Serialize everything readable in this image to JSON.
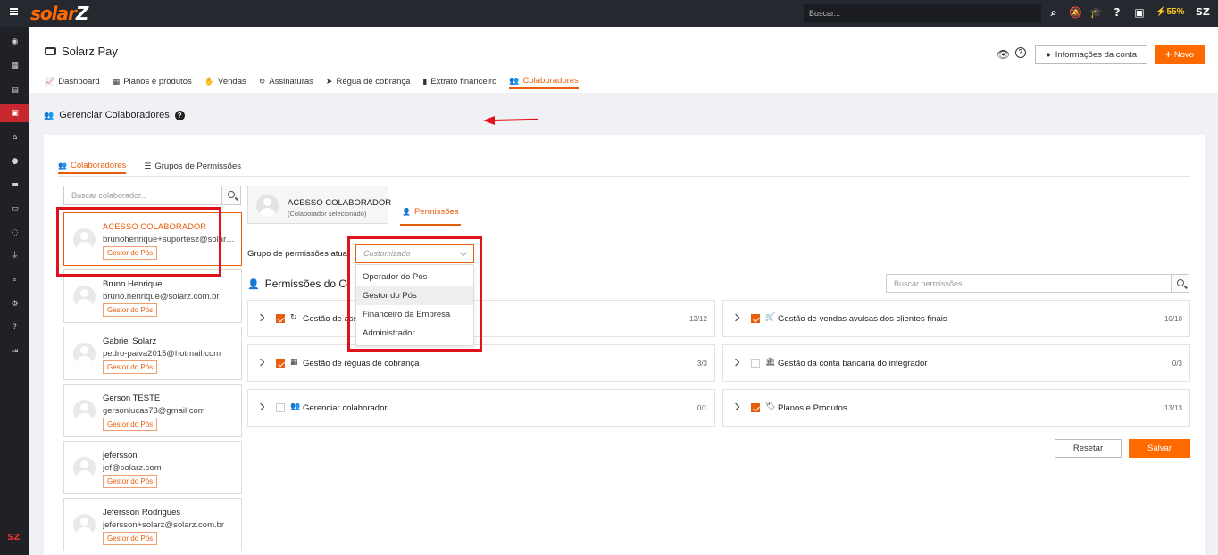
{
  "topbar": {
    "logo_a": "solar",
    "logo_b": "Z",
    "search_placeholder": "Buscar...",
    "battery": "55%",
    "icons": [
      "search-icon",
      "bell-slash-icon",
      "graduation-cap-icon",
      "help-icon",
      "clipboard-icon",
      "battery-icon",
      "user-icon"
    ]
  },
  "sidebar": {
    "items": [
      "dashboard-icon",
      "grid-icon",
      "document-icon",
      "cash-icon",
      "home-icon",
      "user-icon",
      "card-icon",
      "card-alt-icon",
      "whatsapp-icon",
      "plug-icon",
      "search-icon",
      "gear-icon",
      "question-icon",
      "logout-icon"
    ],
    "active_index": 3,
    "footer_logo": "SZ"
  },
  "header": {
    "title": "Solarz Pay",
    "nav": [
      {
        "label": "Dashboard",
        "icon": "chart-line-icon"
      },
      {
        "label": "Planos e produtos",
        "icon": "boxes-icon"
      },
      {
        "label": "Vendas",
        "icon": "hand-holding-icon"
      },
      {
        "label": "Assinaturas",
        "icon": "refresh-icon"
      },
      {
        "label": "Régua de cobrança",
        "icon": "paper-plane-icon"
      },
      {
        "label": "Extrato financeiro",
        "icon": "book-icon"
      },
      {
        "label": "Colaboradores",
        "icon": "users-icon",
        "active": true
      }
    ],
    "account_button": "Informações da conta",
    "new_button": "Novo"
  },
  "page": {
    "heading": "Gerenciar Colaboradores",
    "subtabs": [
      {
        "label": "Colaboradores",
        "active": true
      },
      {
        "label": "Grupos de Permissões"
      }
    ],
    "collab_search_placeholder": "Buscar colaborador...",
    "collaborators": [
      {
        "name": "ACESSO COLABORADOR",
        "email": "brunohenrique+suportesz@solarz.com.br",
        "badge": "Gestor do Pós",
        "selected": true
      },
      {
        "name": "Bruno Henrique",
        "email": "bruno.henrique@solarz.com.br",
        "badge": "Gestor do Pós"
      },
      {
        "name": "Gabriel Solarz",
        "email": "pedro-paiva2015@hotmail.com",
        "badge": "Gestor do Pós"
      },
      {
        "name": "Gerson TESTE",
        "email": "gersonlucas73@gmail.com",
        "badge": "Gestor do Pós"
      },
      {
        "name": "jefersson",
        "email": "jef@solarz.com",
        "badge": "Gestor do Pós"
      },
      {
        "name": "Jefersson Rodrigues",
        "email": "jefersson+solarz@solarz.com.br",
        "badge": "Gestor do Pós"
      }
    ],
    "selected": {
      "name": "ACESSO COLABORADOR",
      "sub": "(Colaborador selecionado)"
    },
    "permissions_tab": "Permissões",
    "group_label": "Grupo de permissões atual",
    "group_value": "Customizado",
    "group_options": [
      "Operador do Pós",
      "Gestor do Pós",
      "Financeiro da Empresa",
      "Administrador"
    ],
    "group_highlighted": 1,
    "perms_heading": "Permissões do Colaborador",
    "perm_search_placeholder": "Buscar permissões...",
    "permissions": [
      {
        "label": "Gestão de assinaturas",
        "count": "12/12",
        "checked": true,
        "icon": "refresh-icon"
      },
      {
        "label": "Gestão de vendas avulsas dos clientes finais",
        "count": "10/10",
        "checked": true,
        "icon": "cart-icon"
      },
      {
        "label": "Gestão de réguas de cobrança",
        "count": "3/3",
        "checked": true,
        "icon": "calendar-check-icon"
      },
      {
        "label": "Gestão da conta bancária do integrador",
        "count": "0/3",
        "checked": false,
        "icon": "bank-icon"
      },
      {
        "label": "Gerenciar colaborador",
        "count": "0/1",
        "checked": false,
        "icon": "users-icon"
      },
      {
        "label": "Planos e Produtos",
        "count": "13/13",
        "checked": true,
        "icon": "tags-icon"
      }
    ],
    "reset_button": "Resetar",
    "save_button": "Salvar"
  },
  "colors": {
    "accent": "#ff6a00",
    "accent_text": "#e85d0b",
    "topbar": "#26282f",
    "annotation": "#e0121b"
  }
}
